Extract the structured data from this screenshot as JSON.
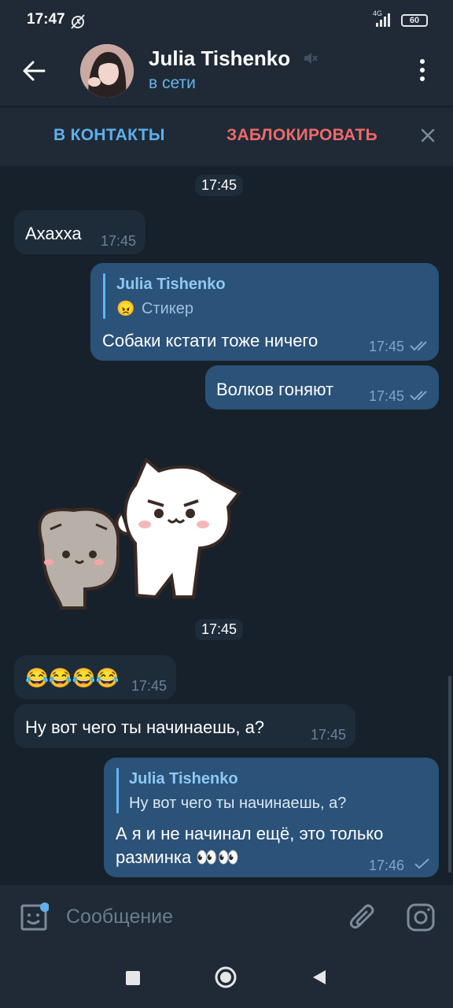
{
  "status_bar": {
    "time": "17:47",
    "network": "4G",
    "battery": "60"
  },
  "header": {
    "name": "Julia Tishenko",
    "status": "в сети"
  },
  "action_bar": {
    "add_contact": "В КОНТАКТЫ",
    "block": "ЗАБЛОКИРОВАТЬ"
  },
  "messages": [
    {
      "type": "date",
      "text": "17:45"
    },
    {
      "type": "in",
      "text": "Ахахха",
      "time": "17:45"
    },
    {
      "type": "out",
      "reply_name": "Julia Tishenko",
      "reply_emoji": "😠",
      "reply_text": "Стикер",
      "text": "Собаки кстати тоже ничего",
      "time": "17:45",
      "status": "read"
    },
    {
      "type": "out",
      "text": "Волков гоняют",
      "time": "17:45",
      "status": "read"
    },
    {
      "type": "sticker",
      "from": "in"
    },
    {
      "type": "date",
      "text": "17:45"
    },
    {
      "type": "in",
      "text": "😂😂😂😂",
      "time": "17:45"
    },
    {
      "type": "in",
      "text": "Ну вот чего ты начинаешь, а?",
      "time": "17:45"
    },
    {
      "type": "out",
      "reply_name": "Julia Tishenko",
      "reply_text": "Ну вот чего ты начинаешь, а?",
      "text_line1": "А я и не начинал ещё, это только",
      "text_line2": "разминка 👀👀",
      "time": "17:46",
      "status": "sent"
    }
  ],
  "input": {
    "placeholder": "Сообщение"
  },
  "colors": {
    "background": "#17212b",
    "header": "#1f2a36",
    "incoming": "#1e2c3a",
    "outgoing": "#2b5278",
    "accent": "#64b5ef",
    "danger": "#ee6a6a"
  },
  "icons": [
    "alarm-off-icon",
    "signal-icon",
    "battery-icon",
    "back-arrow-icon",
    "mute-icon",
    "more-vert-icon",
    "close-icon",
    "double-check-icon",
    "check-icon",
    "sticker-icon",
    "attach-icon",
    "camera-icon",
    "nav-recents-icon",
    "nav-home-icon",
    "nav-back-icon"
  ]
}
